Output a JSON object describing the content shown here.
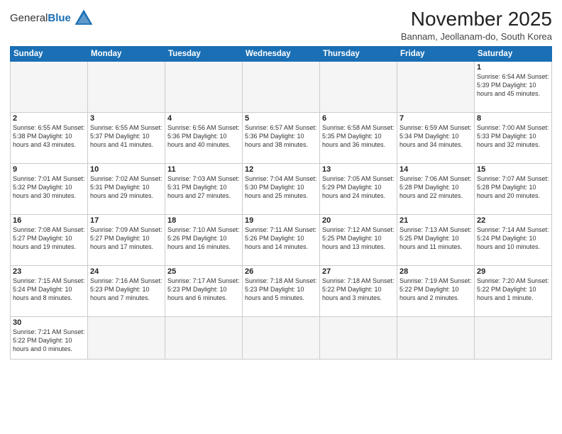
{
  "logo": {
    "general": "General",
    "blue": "Blue"
  },
  "title": "November 2025",
  "subtitle": "Bannam, Jeollanam-do, South Korea",
  "weekdays": [
    "Sunday",
    "Monday",
    "Tuesday",
    "Wednesday",
    "Thursday",
    "Friday",
    "Saturday"
  ],
  "weeks": [
    [
      {
        "day": "",
        "info": ""
      },
      {
        "day": "",
        "info": ""
      },
      {
        "day": "",
        "info": ""
      },
      {
        "day": "",
        "info": ""
      },
      {
        "day": "",
        "info": ""
      },
      {
        "day": "",
        "info": ""
      },
      {
        "day": "1",
        "info": "Sunrise: 6:54 AM\nSunset: 5:39 PM\nDaylight: 10 hours and 45 minutes."
      }
    ],
    [
      {
        "day": "2",
        "info": "Sunrise: 6:55 AM\nSunset: 5:38 PM\nDaylight: 10 hours and 43 minutes."
      },
      {
        "day": "3",
        "info": "Sunrise: 6:55 AM\nSunset: 5:37 PM\nDaylight: 10 hours and 41 minutes."
      },
      {
        "day": "4",
        "info": "Sunrise: 6:56 AM\nSunset: 5:36 PM\nDaylight: 10 hours and 40 minutes."
      },
      {
        "day": "5",
        "info": "Sunrise: 6:57 AM\nSunset: 5:36 PM\nDaylight: 10 hours and 38 minutes."
      },
      {
        "day": "6",
        "info": "Sunrise: 6:58 AM\nSunset: 5:35 PM\nDaylight: 10 hours and 36 minutes."
      },
      {
        "day": "7",
        "info": "Sunrise: 6:59 AM\nSunset: 5:34 PM\nDaylight: 10 hours and 34 minutes."
      },
      {
        "day": "8",
        "info": "Sunrise: 7:00 AM\nSunset: 5:33 PM\nDaylight: 10 hours and 32 minutes."
      }
    ],
    [
      {
        "day": "9",
        "info": "Sunrise: 7:01 AM\nSunset: 5:32 PM\nDaylight: 10 hours and 30 minutes."
      },
      {
        "day": "10",
        "info": "Sunrise: 7:02 AM\nSunset: 5:31 PM\nDaylight: 10 hours and 29 minutes."
      },
      {
        "day": "11",
        "info": "Sunrise: 7:03 AM\nSunset: 5:31 PM\nDaylight: 10 hours and 27 minutes."
      },
      {
        "day": "12",
        "info": "Sunrise: 7:04 AM\nSunset: 5:30 PM\nDaylight: 10 hours and 25 minutes."
      },
      {
        "day": "13",
        "info": "Sunrise: 7:05 AM\nSunset: 5:29 PM\nDaylight: 10 hours and 24 minutes."
      },
      {
        "day": "14",
        "info": "Sunrise: 7:06 AM\nSunset: 5:28 PM\nDaylight: 10 hours and 22 minutes."
      },
      {
        "day": "15",
        "info": "Sunrise: 7:07 AM\nSunset: 5:28 PM\nDaylight: 10 hours and 20 minutes."
      }
    ],
    [
      {
        "day": "16",
        "info": "Sunrise: 7:08 AM\nSunset: 5:27 PM\nDaylight: 10 hours and 19 minutes."
      },
      {
        "day": "17",
        "info": "Sunrise: 7:09 AM\nSunset: 5:27 PM\nDaylight: 10 hours and 17 minutes."
      },
      {
        "day": "18",
        "info": "Sunrise: 7:10 AM\nSunset: 5:26 PM\nDaylight: 10 hours and 16 minutes."
      },
      {
        "day": "19",
        "info": "Sunrise: 7:11 AM\nSunset: 5:26 PM\nDaylight: 10 hours and 14 minutes."
      },
      {
        "day": "20",
        "info": "Sunrise: 7:12 AM\nSunset: 5:25 PM\nDaylight: 10 hours and 13 minutes."
      },
      {
        "day": "21",
        "info": "Sunrise: 7:13 AM\nSunset: 5:25 PM\nDaylight: 10 hours and 11 minutes."
      },
      {
        "day": "22",
        "info": "Sunrise: 7:14 AM\nSunset: 5:24 PM\nDaylight: 10 hours and 10 minutes."
      }
    ],
    [
      {
        "day": "23",
        "info": "Sunrise: 7:15 AM\nSunset: 5:24 PM\nDaylight: 10 hours and 8 minutes."
      },
      {
        "day": "24",
        "info": "Sunrise: 7:16 AM\nSunset: 5:23 PM\nDaylight: 10 hours and 7 minutes."
      },
      {
        "day": "25",
        "info": "Sunrise: 7:17 AM\nSunset: 5:23 PM\nDaylight: 10 hours and 6 minutes."
      },
      {
        "day": "26",
        "info": "Sunrise: 7:18 AM\nSunset: 5:23 PM\nDaylight: 10 hours and 5 minutes."
      },
      {
        "day": "27",
        "info": "Sunrise: 7:18 AM\nSunset: 5:22 PM\nDaylight: 10 hours and 3 minutes."
      },
      {
        "day": "28",
        "info": "Sunrise: 7:19 AM\nSunset: 5:22 PM\nDaylight: 10 hours and 2 minutes."
      },
      {
        "day": "29",
        "info": "Sunrise: 7:20 AM\nSunset: 5:22 PM\nDaylight: 10 hours and 1 minute."
      }
    ],
    [
      {
        "day": "30",
        "info": "Sunrise: 7:21 AM\nSunset: 5:22 PM\nDaylight: 10 hours and 0 minutes."
      },
      {
        "day": "",
        "info": ""
      },
      {
        "day": "",
        "info": ""
      },
      {
        "day": "",
        "info": ""
      },
      {
        "day": "",
        "info": ""
      },
      {
        "day": "",
        "info": ""
      },
      {
        "day": "",
        "info": ""
      }
    ]
  ]
}
